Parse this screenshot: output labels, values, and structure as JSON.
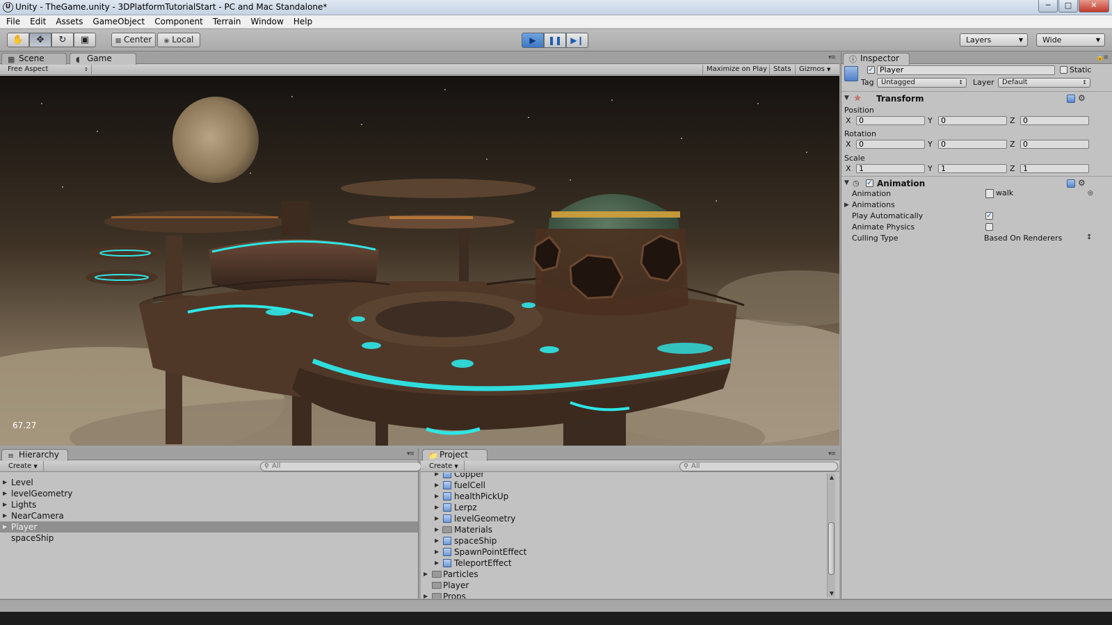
{
  "window": {
    "title": "Unity - TheGame.unity - 3DPlatformTutorialStart - PC and Mac Standalone*",
    "buttons": [
      "─",
      "□",
      "✕"
    ]
  },
  "menu": [
    "File",
    "Edit",
    "Assets",
    "GameObject",
    "Component",
    "Terrain",
    "Window",
    "Help"
  ],
  "toolbar": {
    "pivot_label": "Center",
    "space_label": "Local",
    "layers_label": "Layers",
    "layout_label": "Wide"
  },
  "scene_panel": {
    "tabs": [
      "Scene",
      "Game"
    ],
    "active_tab": "Game",
    "aspect_label": "Free Aspect",
    "maximize_label": "Maximize on Play",
    "stats_label": "Stats",
    "gizmos_label": "Gizmos",
    "fps": "67.27"
  },
  "inspector": {
    "tab_label": "Inspector",
    "object_name": "Player",
    "active_checked": true,
    "static_label": "Static",
    "static_checked": false,
    "tag_label": "Tag",
    "tag_value": "Untagged",
    "layer_label": "Layer",
    "layer_value": "Default",
    "transform": {
      "title": "Transform",
      "position_label": "Position",
      "rotation_label": "Rotation",
      "scale_label": "Scale",
      "position": {
        "x": "0",
        "y": "0",
        "z": "0"
      },
      "rotation": {
        "x": "0",
        "y": "0",
        "z": "0"
      },
      "scale": {
        "x": "1",
        "y": "1",
        "z": "1"
      }
    },
    "animation": {
      "title": "Animation",
      "enabled": true,
      "animation_label": "Animation",
      "animation_value": "walk",
      "animations_label": "Animations",
      "play_auto_label": "Play Automatically",
      "play_auto_checked": true,
      "animate_physics_label": "Animate Physics",
      "animate_physics_checked": false,
      "culling_label": "Culling Type",
      "culling_value": "Based On Renderers"
    }
  },
  "hierarchy": {
    "tab_label": "Hierarchy",
    "create_label": "Create",
    "search_placeholder": "All",
    "items": [
      {
        "label": "Level",
        "expandable": true,
        "selected": false
      },
      {
        "label": "levelGeometry",
        "expandable": true,
        "selected": false
      },
      {
        "label": "Lights",
        "expandable": true,
        "selected": false
      },
      {
        "label": "NearCamera",
        "expandable": true,
        "selected": false
      },
      {
        "label": "Player",
        "expandable": true,
        "selected": true
      },
      {
        "label": "spaceShip",
        "expandable": false,
        "selected": false
      }
    ]
  },
  "project": {
    "tab_label": "Project",
    "create_label": "Create",
    "search_placeholder": "All",
    "items": [
      {
        "label": "Copper",
        "kind": "prefab",
        "indent": 1
      },
      {
        "label": "fuelCell",
        "kind": "prefab",
        "indent": 1
      },
      {
        "label": "healthPickUp",
        "kind": "prefab",
        "indent": 1
      },
      {
        "label": "Lerpz",
        "kind": "prefab",
        "indent": 1
      },
      {
        "label": "levelGeometry",
        "kind": "prefab",
        "indent": 1
      },
      {
        "label": "Materials",
        "kind": "folder",
        "indent": 1
      },
      {
        "label": "spaceShip",
        "kind": "prefab",
        "indent": 1
      },
      {
        "label": "SpawnPointEffect",
        "kind": "prefab",
        "indent": 1
      },
      {
        "label": "TeleportEffect",
        "kind": "prefab",
        "indent": 1
      },
      {
        "label": "Particles",
        "kind": "folder",
        "indent": 0
      },
      {
        "label": "Player",
        "kind": "folder",
        "indent": 0
      },
      {
        "label": "Props",
        "kind": "folder",
        "indent": 0
      }
    ]
  },
  "colors": {
    "editor_bg": "#c2c2c2",
    "neon": "#2ee6e6",
    "sky": "#3a2e22"
  }
}
